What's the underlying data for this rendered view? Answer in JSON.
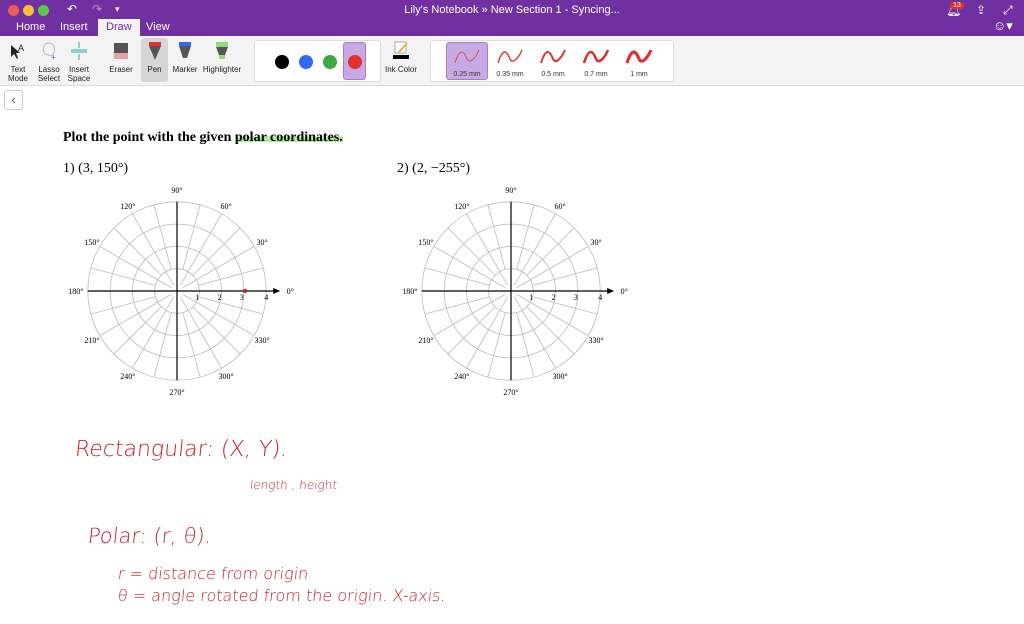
{
  "window": {
    "title": "Lily's Notebook  »  New Section 1 - Syncing...",
    "notifications": "13"
  },
  "tabs": [
    {
      "label": "Home"
    },
    {
      "label": "Insert"
    },
    {
      "label": "Draw"
    },
    {
      "label": "View"
    }
  ],
  "ribbon": {
    "text_mode": "Text Mode",
    "lasso": "Lasso Select",
    "insert_space": "Insert Space",
    "eraser": "Eraser",
    "pen": "Pen",
    "marker": "Marker",
    "highlighter": "Highlighter",
    "ink_color": "Ink Color",
    "colors": [
      "#000000",
      "#2e6bf0",
      "#3fa845",
      "#e0322a"
    ],
    "thickness": [
      "0.25 mm",
      "0.35 mm",
      "0.5 mm",
      "0.7 mm",
      "1 mm"
    ]
  },
  "page": {
    "heading_a": "Plot the point with the given ",
    "heading_b": "polar coordinates.",
    "problems": [
      {
        "label": "1)  (3, 150°)"
      },
      {
        "label": "2)  (2, −255°)"
      }
    ],
    "angle_labels": [
      "0°",
      "30°",
      "60°",
      "90°",
      "120°",
      "150°",
      "180°",
      "210°",
      "240°",
      "270°",
      "300°",
      "330°"
    ],
    "radius_labels": [
      "1",
      "2",
      "3",
      "4"
    ]
  },
  "handwriting": {
    "l1": "Rectangular:  (X, Y).",
    "l2": "length , height",
    "l3": "Polar:  (r, θ).",
    "l4": "r = distance from  origin",
    "l5": "θ = angle rotated from the origin.  X-axis."
  },
  "accent": "#7030a0"
}
